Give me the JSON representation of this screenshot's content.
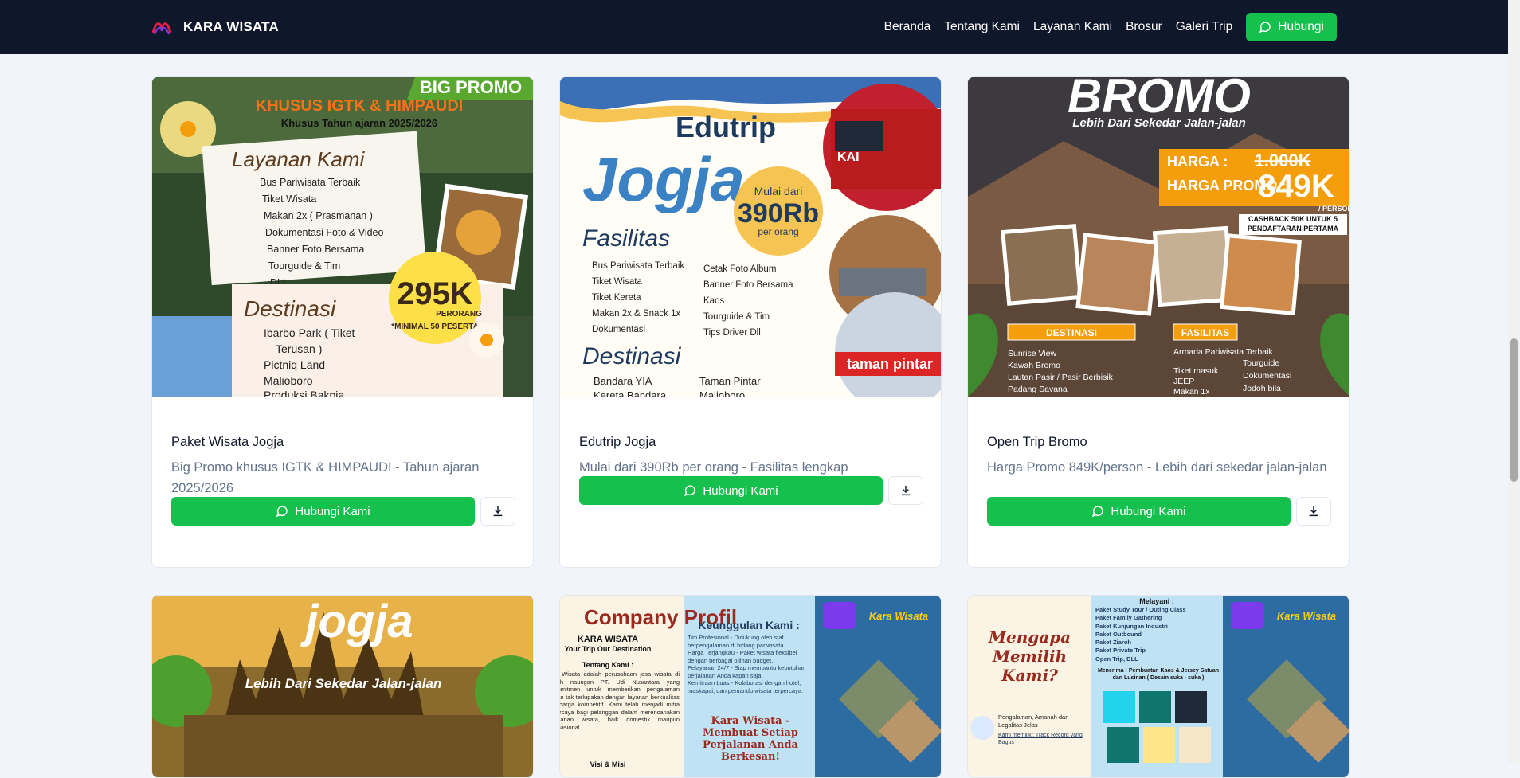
{
  "brand": {
    "name": "KARA WISATA"
  },
  "nav": {
    "items": [
      "Beranda",
      "Tentang Kami",
      "Layanan Kami",
      "Brosur",
      "Galeri Trip"
    ],
    "cta_label": "Hubungi"
  },
  "cards": [
    {
      "title": "Paket Wisata Jogja",
      "description": "Big Promo khusus IGTK & HIMPAUDI - Tahun ajaran 2025/2026",
      "button_label": "Hubungi Kami",
      "poster": {
        "banner": "BIG PROMO",
        "headline": "KHUSUS IGTK & HIMPAUDI",
        "subhead": "Khusus Tahun ajaran 2025/2026",
        "services_title": "Layanan Kami",
        "services": [
          "Bus Pariwisata Terbaik",
          "Tiket Wisata",
          "Makan 2x ( Prasmanan )",
          "Dokumentasi Foto & Video",
          "Banner Foto Bersama",
          "Tourguide & Tim",
          "DLL"
        ],
        "price": "295K",
        "price_unit": "PERORANG",
        "price_note": "*MINIMAL 50 PESERTA",
        "dest_title": "Destinasi",
        "destinations": [
          "Ibarbo Park ( Tiket",
          "Terusan )",
          "Pictniq Land",
          "Malioboro",
          "Produksi Bakpia"
        ]
      }
    },
    {
      "title": "Edutrip Jogja",
      "description": "Mulai dari 390Rb per orang - Fasilitas lengkap",
      "button_label": "Hubungi Kami",
      "poster": {
        "title_top": "Edutrip",
        "title_main": "Jogja",
        "price_from": "Mulai dari",
        "price": "390Rb",
        "price_unit": "per orang",
        "fac_title": "Fasilitas",
        "facilities_left": [
          "Bus Pariwisata Terbaik",
          "Tiket Wisata",
          "Tiket Kereta",
          "Makan 2x & Snack 1x",
          "Dokumentasi"
        ],
        "facilities_right": [
          "Cetak Foto Album",
          "Banner Foto Bersama",
          "Kaos",
          "Tourguide & Tim",
          "Tips Driver Dll"
        ],
        "dest_title": "Destinasi",
        "destinations_left": [
          "Bandara YIA",
          "Kereta Bandara"
        ],
        "destinations_right": [
          "Taman Pintar",
          "Malioboro"
        ],
        "train_label": "KAI",
        "park_label": "taman pintar"
      }
    },
    {
      "title": "Open Trip Bromo",
      "description": "Harga Promo 849K/person - Lebih dari sekedar jalan-jalan",
      "button_label": "Hubungi Kami",
      "poster": {
        "headline": "BROMO",
        "tagline": "Lebih Dari Sekedar Jalan-jalan",
        "harga_label": "HARGA :",
        "harga_old": "1.000K",
        "promo_label": "HARGA PROMO :",
        "promo_price": "849K",
        "per_person": "/ PERSON",
        "cashback": "CASHBACK 50K UNTUK 5 PENDAFTARAN PERTAMA",
        "dest_title": "DESTINASI",
        "destinations": [
          "Sunrise View",
          "Kawah Bromo",
          "Lautan Pasir / Pasir Berbisik",
          "Padang Savana"
        ],
        "fac_title": "FASILITAS",
        "facilities_left": [
          "Armada Pariwisata Terbaik",
          "Tiket masuk",
          "JEEP",
          "Makan 1x"
        ],
        "facilities_right": [
          "Tourguide",
          "Dokumentasi",
          "Jodoh bila"
        ]
      }
    }
  ],
  "cards_row2": [
    {
      "poster": {
        "headline": "jogja",
        "tagline": "Lebih Dari Sekedar Jalan-jalan"
      }
    },
    {
      "poster": {
        "title": "Company Profil",
        "company": "KARA WISATA",
        "motto": "Your Trip Our Destination",
        "about_title": "Tentang Kami :",
        "about_text": "Kara Wisata adalah perusahaan jasa wisata di bawah naungan PT. Udi Nusantara yang berkomitmen untuk memberikan pengalaman liburan tak terlupakan dengan layanan berkualitas dan harga kompetitif. Kami telah menjadi mitra terpercaya bagi pelanggan dalam merencanakan perjalanan wisata, baik domestik maupun internasional.",
        "visi": "Visi & Misi",
        "adv_title": "Keunggulan Kami :",
        "advantages": [
          "Tim Profesional - Didukung oleh staf berpengalaman di bidang pariwisata.",
          "Harga Terjangkau - Paket wisata fleksibel dengan berbagai pilihan budget.",
          "Pelayanan 24/7 - Siap membantu kebutuhan perjalanan Anda kapan saja.",
          "Kemitraan Luas - Kolaborasi dengan hotel, maskapai, dan pemandu wisata terpercaya."
        ],
        "slogan": "Kara Wisata - Membuat Setiap Perjalanan Anda Berkesan!",
        "logo_text": "Kara Wisata"
      }
    },
    {
      "poster": {
        "question": "Mengapa Memilih Kami?",
        "reason": "Pengalaman, Amanah dan Legalitas Jelas",
        "reason_sub": "Kami memiliki: Track Record yang Bagus",
        "services_title": "Melayani :",
        "services": [
          "Paket Study Tour / Outing Class",
          "Paket Family Gathering",
          "Paket Kunjungan Industri",
          "Paket Outbound",
          "Paket Ziaroh",
          "Paket Private Trip",
          "Open Trip, DLL"
        ],
        "merch": "Menerima : Pembuatan Kaos & Jersey Satuan dan Lusinan ( Desain suka - suka )",
        "logo_text": "Kara Wisata"
      }
    }
  ],
  "colors": {
    "nav_bg": "#0f172a",
    "accent_green": "#16c04d",
    "page_bg": "#f1f5f9",
    "text_muted": "#64748b"
  },
  "icons": {
    "chat": "message-circle-icon",
    "download": "download-icon"
  }
}
